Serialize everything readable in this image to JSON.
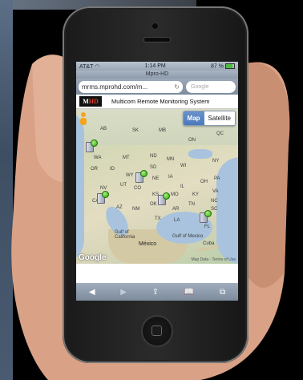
{
  "status_bar": {
    "carrier": "AT&T",
    "wifi": "wifi-icon",
    "time": "1:14 PM",
    "battery": "87 %"
  },
  "browser": {
    "title": "Mpro-HD",
    "url": "mrms.mprohd.com/m...",
    "search_placeholder": "Google"
  },
  "site": {
    "logo_text": "M",
    "logo_accent": "HD",
    "system_name": "Multicom Remote Monitoring System"
  },
  "map": {
    "type_buttons": [
      {
        "label": "Map",
        "active": true
      },
      {
        "label": "Satellite",
        "active": false
      }
    ],
    "labels": [
      "AB",
      "SK",
      "MB",
      "ON",
      "QC",
      "WA",
      "MT",
      "ND",
      "MN",
      "OR",
      "ID",
      "SD",
      "WI",
      "NY",
      "WY",
      "NE",
      "IA",
      "NV",
      "UT",
      "CO",
      "IL",
      "OH",
      "PA",
      "CA",
      "KS",
      "MO",
      "KY",
      "VA",
      "AZ",
      "NM",
      "OK",
      "TN",
      "NC",
      "AR",
      "SC",
      "TX",
      "LA",
      "FL",
      "Gulf of California",
      "Gulf of Mexico",
      "México",
      "Cuba"
    ],
    "brand": "Google",
    "terms": "Map Data · Terms of Use",
    "colors": {
      "marker_online": "#2fa412",
      "map_active_button": "#4a79bc",
      "logo_accent": "#e03a2f"
    }
  },
  "toolbar": {
    "back": "◀",
    "forward": "▶",
    "share": "⇪",
    "bookmarks": "📖",
    "tabs": "⧉"
  }
}
